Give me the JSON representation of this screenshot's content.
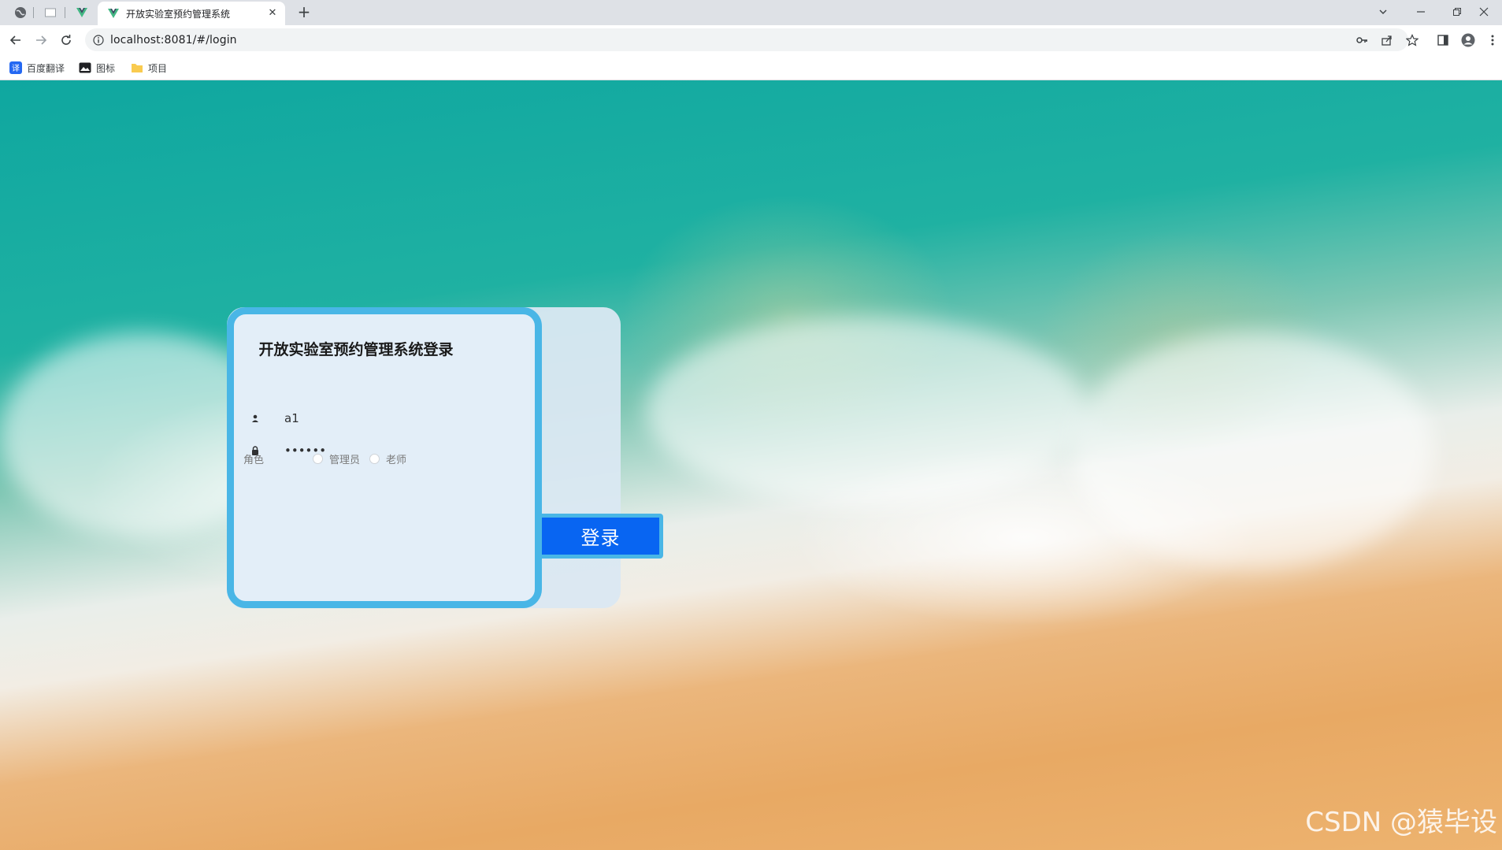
{
  "browser": {
    "tab_title": "开放实验室预约管理系统",
    "url": "localhost:8081/#/login",
    "bookmarks": [
      {
        "label": "百度翻译",
        "icon": "translate-icon"
      },
      {
        "label": "图标",
        "icon": "image-icon"
      },
      {
        "label": "项目",
        "icon": "folder-icon"
      }
    ]
  },
  "login": {
    "title": "开放实验室预约管理系统登录",
    "username_value": "a1",
    "password_value": "••••••",
    "role_label": "角色",
    "role_options": [
      "管理员",
      "老师"
    ],
    "submit_label": "登录"
  },
  "watermark": "CSDN @猿毕设",
  "colors": {
    "form_border": "#49b6e6",
    "button_bg": "#0865f2",
    "form_bg": "#e3eef8"
  }
}
